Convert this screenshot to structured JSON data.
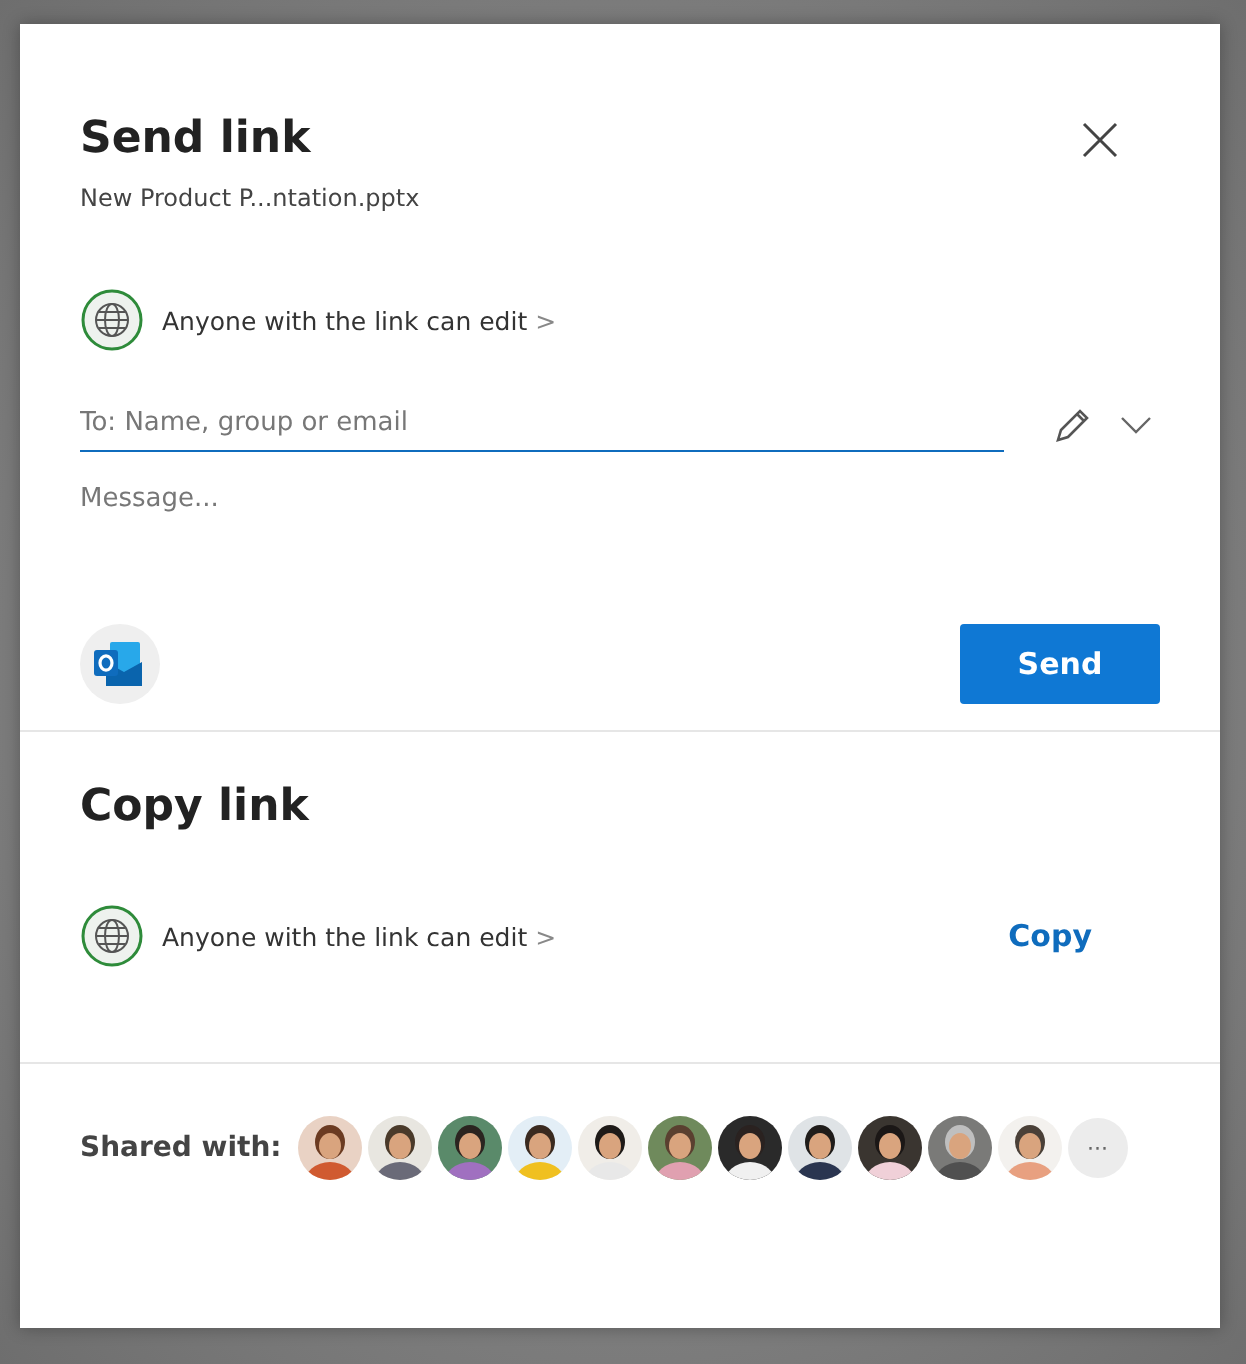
{
  "send_link": {
    "title": "Send link",
    "file_name": "New Product P...ntation.pptx",
    "permission": "Anyone with the link can edit",
    "chevron": ">",
    "to_field": {
      "placeholder": "To: Name, group or email"
    },
    "message": {
      "placeholder": "Message..."
    },
    "send_button": "Send"
  },
  "copy_link": {
    "title": "Copy link",
    "permission": "Anyone with the link can edit",
    "chevron": ">",
    "copy_button": "Copy"
  },
  "shared_with": {
    "label": "Shared with:",
    "more_button": "···"
  }
}
